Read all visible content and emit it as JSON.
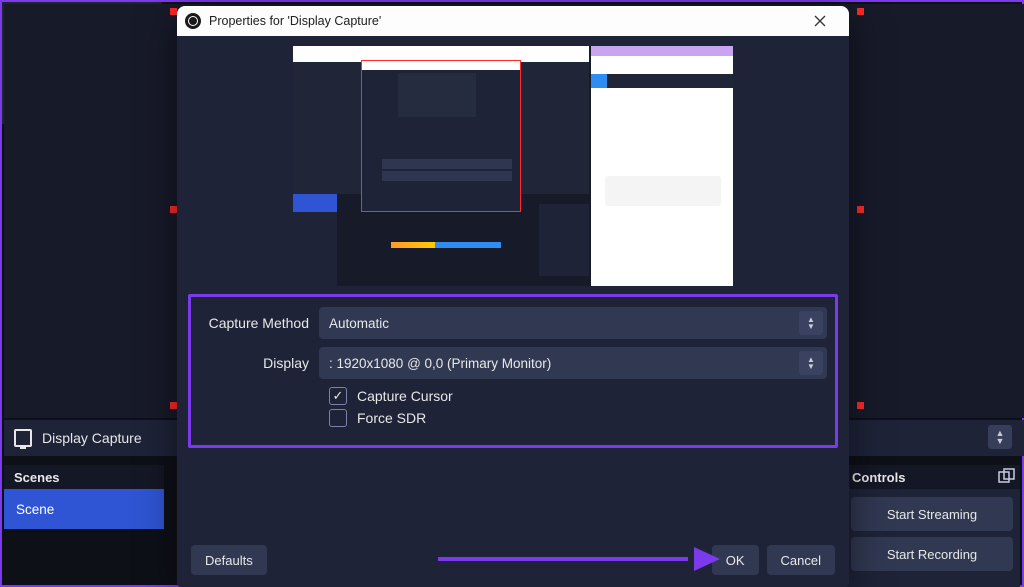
{
  "dialog": {
    "title": "Properties for 'Display Capture'",
    "form": {
      "capture_method_label": "Capture Method",
      "capture_method_value": "Automatic",
      "display_label": "Display",
      "display_value": ": 1920x1080 @ 0,0 (Primary Monitor)",
      "capture_cursor_label": "Capture Cursor",
      "capture_cursor_checked": true,
      "force_sdr_label": "Force SDR",
      "force_sdr_checked": false
    },
    "buttons": {
      "defaults": "Defaults",
      "ok": "OK",
      "cancel": "Cancel"
    }
  },
  "main_window": {
    "sources": {
      "display_capture": "Display Capture"
    },
    "scenes_header": "Scenes",
    "scene_name": "Scene",
    "controls_header": "Controls",
    "start_streaming": "Start Streaming",
    "start_recording": "Start Recording"
  }
}
